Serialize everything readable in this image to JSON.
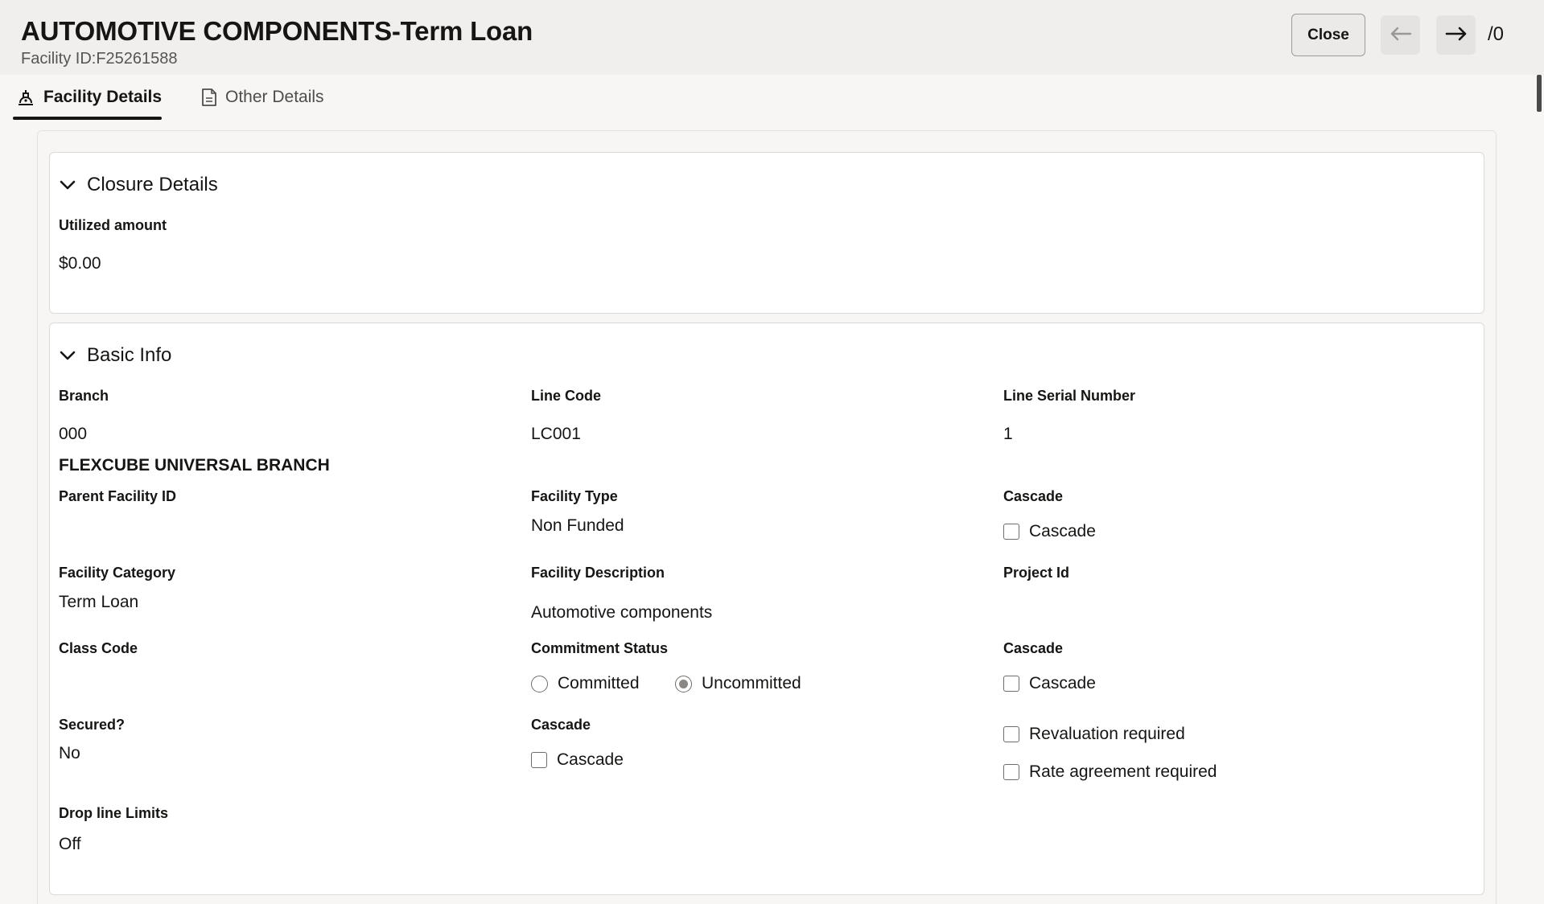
{
  "header": {
    "title": "AUTOMOTIVE COMPONENTS-Term Loan",
    "subtitle": "Facility ID:F25261588",
    "close_label": "Close",
    "prev_icon": "arrow-left-icon",
    "next_icon": "arrow-right-icon",
    "counter": "/0"
  },
  "tabs": [
    {
      "label": "Facility Details",
      "icon": "facility-icon",
      "selected": true
    },
    {
      "label": "Other Details",
      "icon": "document-icon",
      "selected": false
    }
  ],
  "closure": {
    "title": "Closure Details",
    "utilized_label": "Utilized amount",
    "utilized_value": "$0.00"
  },
  "basic": {
    "title": "Basic Info",
    "branch_label": "Branch",
    "branch_code": "000",
    "branch_name": "FLEXCUBE UNIVERSAL BRANCH",
    "line_code_label": "Line Code",
    "line_code_value": "LC001",
    "line_serial_label": "Line Serial Number",
    "line_serial_value": "1",
    "parent_label": "Parent Facility ID",
    "facility_type_label": "Facility Type",
    "facility_type_value": "Non Funded",
    "cascade1_label": "Cascade",
    "cascade1_check": "Cascade",
    "category_label": "Facility Category",
    "category_value": "Term Loan",
    "description_label": "Facility Description",
    "description_value": "Automotive components",
    "project_label": "Project Id",
    "class_label": "Class Code",
    "commitment_label": "Commitment Status",
    "committed_option": "Committed",
    "uncommitted_option": "Uncommitted",
    "commitment_selected": "Uncommitted",
    "cascade2_label": "Cascade",
    "cascade2_check": "Cascade",
    "secured_label": "Secured?",
    "secured_value": "No",
    "cascade3_label": "Cascade",
    "cascade3_check": "Cascade",
    "revaluation_check": "Revaluation required",
    "rate_check": "Rate agreement required",
    "dropline_label": "Drop line Limits",
    "dropline_value": "Off"
  }
}
